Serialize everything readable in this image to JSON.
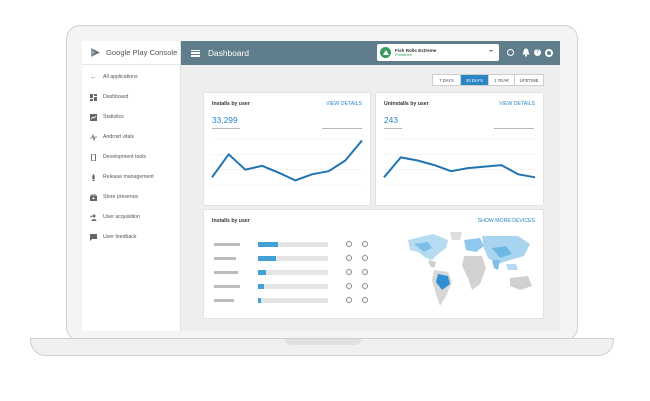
{
  "brand": {
    "name": "Google Play Console"
  },
  "sidebar": {
    "items": [
      {
        "label": "All applications",
        "icon": "arrow-back-icon"
      },
      {
        "label": "Dashboard",
        "icon": "dashboard-icon"
      },
      {
        "label": "Statistics",
        "icon": "statistics-icon"
      },
      {
        "label": "Android vitals",
        "icon": "vitals-icon"
      },
      {
        "label": "Development tools",
        "icon": "phone-icon"
      },
      {
        "label": "Release management",
        "icon": "rocket-icon"
      },
      {
        "label": "Store presence",
        "icon": "store-icon"
      },
      {
        "label": "User acquisition",
        "icon": "user-add-icon"
      },
      {
        "label": "User feedback",
        "icon": "feedback-icon"
      }
    ]
  },
  "header": {
    "title": "Dashboard",
    "app": {
      "name": "Fish Rolls Extreme",
      "status": "Published"
    }
  },
  "ranges": {
    "items": [
      "7 DAYS",
      "30 DAYS",
      "1 YEAR",
      "LIFETIME"
    ],
    "selected": "30 DAYS"
  },
  "installs_card": {
    "title": "Installs by user",
    "link": "VIEW DETAILS",
    "value": "33,299"
  },
  "uninstalls_card": {
    "title": "Uninstalls by user",
    "link": "VIEW DETAILS",
    "value": "243"
  },
  "devices_card": {
    "title": "Installs by user",
    "link": "SHOW MORE DEVICES"
  },
  "chart_data": [
    {
      "type": "line",
      "series": [
        {
          "values": [
            3,
            6,
            4,
            4.5,
            3.6,
            2.6,
            3.4,
            3.8,
            5.2,
            7.8
          ]
        }
      ]
    },
    {
      "type": "line",
      "series": [
        {
          "values": [
            3,
            5.6,
            5.2,
            4.6,
            3.8,
            4.2,
            4.4,
            4.6,
            3.4,
            3.0
          ]
        }
      ]
    }
  ],
  "device_rows": [
    {
      "share": 0.28
    },
    {
      "share": 0.26
    },
    {
      "share": 0.12
    },
    {
      "share": 0.08
    },
    {
      "share": 0.04
    }
  ],
  "colors": {
    "accent": "#2a86c5",
    "header": "#607d8b",
    "line": "#1e73b0",
    "map_highlight": "#3f9fd9"
  }
}
